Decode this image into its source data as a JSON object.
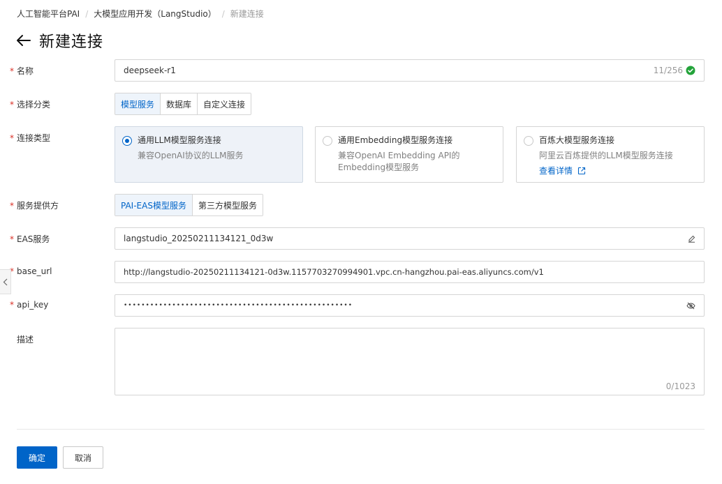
{
  "breadcrumb": {
    "items": [
      "人工智能平台PAI",
      "大模型应用开发（LangStudio）",
      "新建连接"
    ],
    "separator": "/"
  },
  "page": {
    "title": "新建连接",
    "back_icon": "arrow-left-icon"
  },
  "form": {
    "name": {
      "label": "名称",
      "value": "deepseek-r1",
      "counter": "11/256",
      "status_icon": "check-circle-icon"
    },
    "category": {
      "label": "选择分类",
      "options": [
        "模型服务",
        "数据库",
        "自定义连接"
      ],
      "selected": "模型服务"
    },
    "connection_type": {
      "label": "连接类型",
      "cards": [
        {
          "title": "通用LLM模型服务连接",
          "desc": "兼容OpenAI协议的LLM服务",
          "selected": true
        },
        {
          "title": "通用Embedding模型服务连接",
          "desc": "兼容OpenAI Embedding API的Embedding模型服务",
          "selected": false
        },
        {
          "title": "百炼大模型服务连接",
          "desc": "阿里云百炼提供的LLM模型服务连接",
          "link": "查看详情",
          "link_icon": "external-link-icon",
          "selected": false
        }
      ]
    },
    "provider": {
      "label": "服务提供方",
      "options": [
        "PAI-EAS模型服务",
        "第三方模型服务"
      ],
      "selected": "PAI-EAS模型服务"
    },
    "eas_service": {
      "label": "EAS服务",
      "value": "langstudio_20250211134121_0d3w",
      "icon": "edit-icon"
    },
    "base_url": {
      "label": "base_url",
      "value": "http://langstudio-20250211134121-0d3w.1157703270994901.vpc.cn-hangzhou.pai-eas.aliyuncs.com/v1"
    },
    "api_key": {
      "label": "api_key",
      "value": "••••••••••••••••••••••••••••••••••••••••••••••••••••",
      "icon": "eye-off-icon"
    },
    "description": {
      "label": "描述",
      "value": "",
      "counter": "0/1023"
    }
  },
  "actions": {
    "confirm": "确定",
    "cancel": "取消"
  },
  "colors": {
    "primary": "#0064c8",
    "required": "#d93026",
    "success": "#23a33a"
  }
}
